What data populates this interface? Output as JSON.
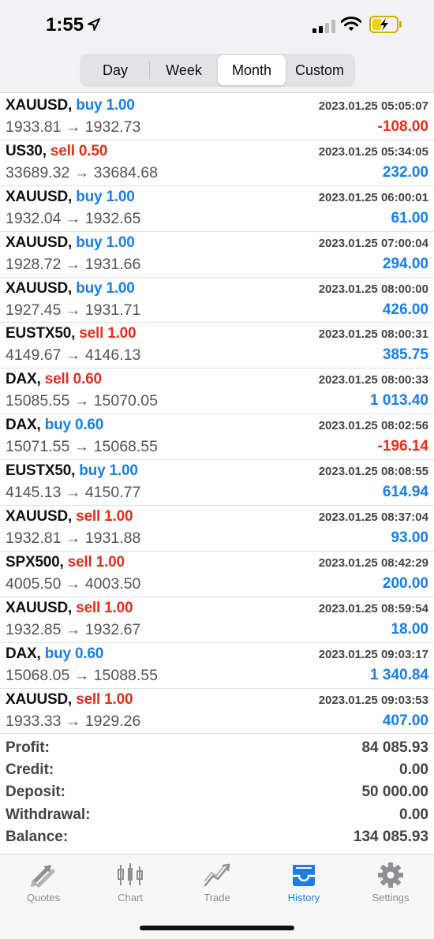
{
  "status_bar": {
    "time": "1:55",
    "icons": [
      "location-arrow-icon",
      "cellular-signal-icon",
      "wifi-icon",
      "battery-charging-icon"
    ]
  },
  "period_tabs": {
    "items": [
      {
        "label": "Day"
      },
      {
        "label": "Week"
      },
      {
        "label": "Month"
      },
      {
        "label": "Custom"
      }
    ],
    "selected": "Month"
  },
  "colors": {
    "buy": "#1a7ee6",
    "sell": "#e0301e",
    "profit_positive": "#1a7ee6",
    "profit_negative": "#e0301e"
  },
  "deals": [
    {
      "symbol": "XAUUSD,",
      "side": "buy 1.00",
      "prices": "1933.81 → 1932.73",
      "time": "2023.01.25 05:05:07",
      "profit": "-108.00"
    },
    {
      "symbol": "US30,",
      "side": "sell 0.50",
      "prices": "33689.32 → 33684.68",
      "time": "2023.01.25 05:34:05",
      "profit": "232.00"
    },
    {
      "symbol": "XAUUSD,",
      "side": "buy 1.00",
      "prices": "1932.04 → 1932.65",
      "time": "2023.01.25 06:00:01",
      "profit": "61.00"
    },
    {
      "symbol": "XAUUSD,",
      "side": "buy 1.00",
      "prices": "1928.72 → 1931.66",
      "time": "2023.01.25 07:00:04",
      "profit": "294.00"
    },
    {
      "symbol": "XAUUSD,",
      "side": "buy 1.00",
      "prices": "1927.45 → 1931.71",
      "time": "2023.01.25 08:00:00",
      "profit": "426.00"
    },
    {
      "symbol": "EUSTX50,",
      "side": "sell 1.00",
      "prices": "4149.67 → 4146.13",
      "time": "2023.01.25 08:00:31",
      "profit": "385.75"
    },
    {
      "symbol": "DAX,",
      "side": "sell 0.60",
      "prices": "15085.55 → 15070.05",
      "time": "2023.01.25 08:00:33",
      "profit": "1 013.40"
    },
    {
      "symbol": "DAX,",
      "side": "buy 0.60",
      "prices": "15071.55 → 15068.55",
      "time": "2023.01.25 08:02:56",
      "profit": "-196.14"
    },
    {
      "symbol": "EUSTX50,",
      "side": "buy 1.00",
      "prices": "4145.13 → 4150.77",
      "time": "2023.01.25 08:08:55",
      "profit": "614.94"
    },
    {
      "symbol": "XAUUSD,",
      "side": "sell 1.00",
      "prices": "1932.81 → 1931.88",
      "time": "2023.01.25 08:37:04",
      "profit": "93.00"
    },
    {
      "symbol": "SPX500,",
      "side": "sell 1.00",
      "prices": "4005.50 → 4003.50",
      "time": "2023.01.25 08:42:29",
      "profit": "200.00"
    },
    {
      "symbol": "XAUUSD,",
      "side": "sell 1.00",
      "prices": "1932.85 → 1932.67",
      "time": "2023.01.25 08:59:54",
      "profit": "18.00"
    },
    {
      "symbol": "DAX,",
      "side": "buy 0.60",
      "prices": "15068.05 → 15088.55",
      "time": "2023.01.25 09:03:17",
      "profit": "1 340.84"
    },
    {
      "symbol": "XAUUSD,",
      "side": "sell 1.00",
      "prices": "1933.33 → 1929.26",
      "time": "2023.01.25 09:03:53",
      "profit": "407.00"
    }
  ],
  "summary": [
    {
      "label": "Profit:",
      "value": "84 085.93"
    },
    {
      "label": "Credit:",
      "value": "0.00"
    },
    {
      "label": "Deposit:",
      "value": "50 000.00"
    },
    {
      "label": "Withdrawal:",
      "value": "0.00"
    },
    {
      "label": "Balance:",
      "value": "134 085.93"
    }
  ],
  "tab_bar": {
    "items": [
      {
        "label": "Quotes",
        "icon": "quotes-arrows-icon"
      },
      {
        "label": "Chart",
        "icon": "candlestick-chart-icon"
      },
      {
        "label": "Trade",
        "icon": "trade-trend-icon"
      },
      {
        "label": "History",
        "icon": "history-inbox-icon"
      },
      {
        "label": "Settings",
        "icon": "gear-icon"
      }
    ],
    "selected": "History"
  }
}
